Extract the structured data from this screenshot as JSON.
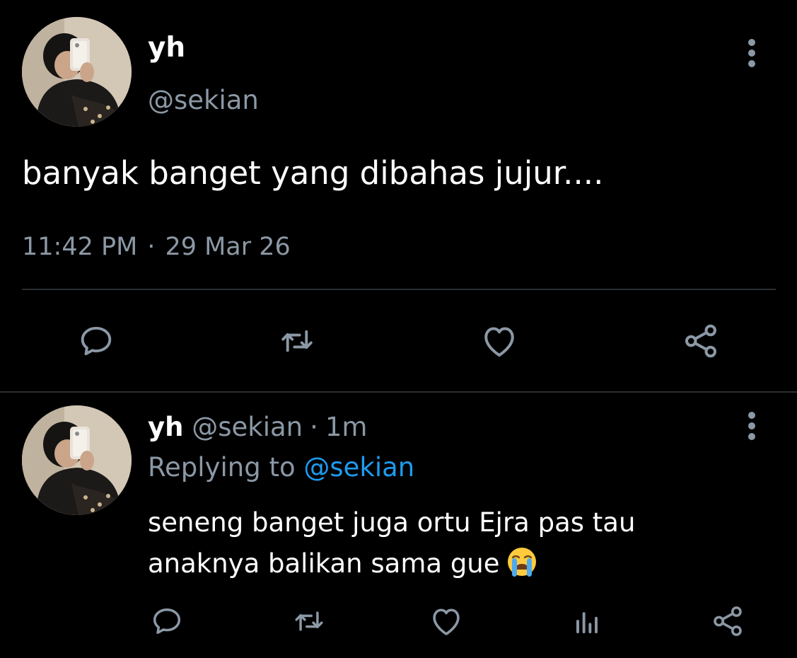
{
  "main_tweet": {
    "display_name": "yh",
    "handle": "@sekian",
    "text": "banyak banget yang dibahas jujur....",
    "time": "11:42 PM",
    "separator": "·",
    "date": "29 Mar 26",
    "more_icon": "more-vertical-icon",
    "actions": [
      {
        "name": "reply",
        "icon": "comment-icon"
      },
      {
        "name": "retweet",
        "icon": "retweet-icon"
      },
      {
        "name": "like",
        "icon": "heart-icon"
      },
      {
        "name": "share",
        "icon": "share-icon"
      }
    ]
  },
  "reply_tweet": {
    "display_name": "yh",
    "handle": "@sekian",
    "separator": "·",
    "relative_time": "1m",
    "replying_prefix": "Replying to",
    "replying_to": "@sekian",
    "text_line1": "seneng banget juga ortu Ejra pas tau",
    "text_line2": "anaknya balikan sama gue",
    "emoji": "loudly-crying-face-emoji",
    "more_icon": "more-vertical-icon",
    "actions": [
      {
        "name": "reply",
        "icon": "comment-icon"
      },
      {
        "name": "retweet",
        "icon": "retweet-icon"
      },
      {
        "name": "like",
        "icon": "heart-icon"
      },
      {
        "name": "analytics",
        "icon": "analytics-icon"
      },
      {
        "name": "share",
        "icon": "share-icon"
      }
    ]
  },
  "colors": {
    "background": "#000000",
    "primary_text": "#ffffff",
    "secondary_text": "#8b98a5",
    "link": "#1d9bf0",
    "divider": "#2a2f33",
    "icon": "#8b98a5"
  }
}
